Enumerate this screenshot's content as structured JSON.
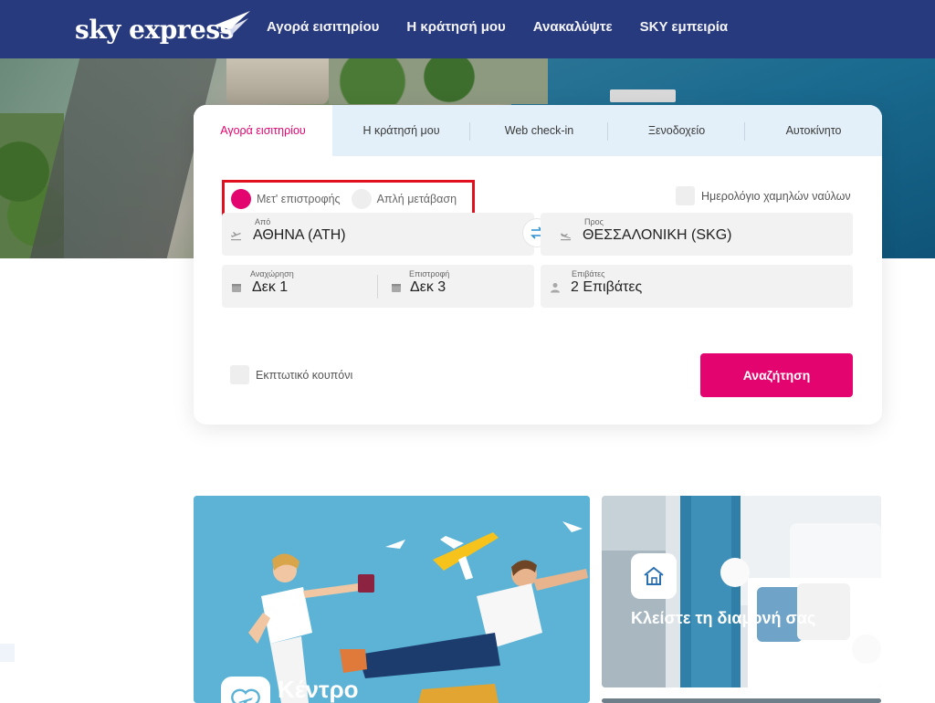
{
  "brand": {
    "name": "sky express"
  },
  "nav": {
    "items": [
      {
        "label": "Αγορά εισιτηρίου"
      },
      {
        "label": "Η κράτησή μου"
      },
      {
        "label": "Ανακαλύψτε"
      },
      {
        "label": "SKY εμπειρία"
      }
    ]
  },
  "booking": {
    "tabs": [
      {
        "label": "Αγορά εισιτηρίου",
        "active": true
      },
      {
        "label": "Η κράτησή μου"
      },
      {
        "label": "Web check-in"
      },
      {
        "label": "Ξενοδοχείο"
      },
      {
        "label": "Αυτοκίνητο"
      }
    ],
    "trip_types": [
      {
        "label": "Μετ' επιστροφής",
        "selected": true
      },
      {
        "label": "Απλή μετάβαση",
        "selected": false
      }
    ],
    "low_fare_calendar_label": "Ημερολόγιο χαμηλών ναύλων",
    "from": {
      "label": "Από",
      "value": "ΑΘΗΝΑ (ATH)"
    },
    "to": {
      "label": "Προς",
      "value": "ΘΕΣΣΑΛΟΝΙΚΗ (SKG)"
    },
    "departure": {
      "label": "Αναχώρηση",
      "value": "Δεκ 1"
    },
    "return": {
      "label": "Επιστροφή",
      "value": "Δεκ 3"
    },
    "passengers": {
      "label": "Επιβάτες",
      "value": "2 Επιβάτες"
    },
    "coupon_label": "Εκπτωτικό κουπόνι",
    "search_label": "Αναζήτηση"
  },
  "promos": {
    "help_center_title": "Κέντρο",
    "hotel_title": "Κλείστε τη διαμονή σας"
  },
  "colors": {
    "nav_bg": "#283a7e",
    "accent": "#e3046f",
    "highlight_border": "#e0101e",
    "tab_bar_bg": "#e3f0f9"
  }
}
